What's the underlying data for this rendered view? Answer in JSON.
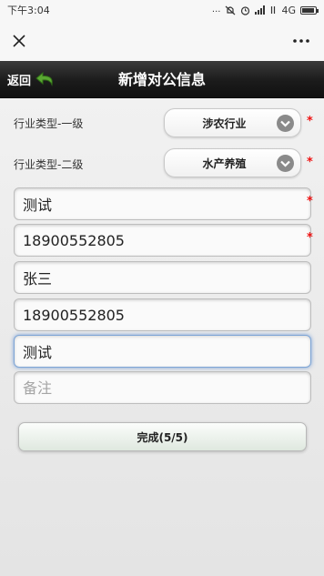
{
  "status_bar": {
    "time": "下午3:04",
    "dots": "...",
    "network": "4G"
  },
  "webview": {
    "close_icon": "close-icon",
    "more_icon": "more-dots-icon"
  },
  "header": {
    "back_label": "返回",
    "title": "新增对公信息",
    "back_icon_color": "#5aa832"
  },
  "form": {
    "industry_level1": {
      "label": "行业类型-一级",
      "value": "涉农行业",
      "required": "*"
    },
    "industry_level2": {
      "label": "行业类型-二级",
      "value": "水产养殖",
      "required": "*"
    },
    "fields": [
      {
        "value": "测试",
        "placeholder": "",
        "required": "*"
      },
      {
        "value": "18900552805",
        "placeholder": "",
        "required": "*"
      },
      {
        "value": "张三",
        "placeholder": ""
      },
      {
        "value": "18900552805",
        "placeholder": ""
      },
      {
        "value": "测试",
        "placeholder": ""
      },
      {
        "value": "",
        "placeholder": "备注"
      }
    ],
    "submit_label": "完成(5/5)"
  },
  "colors": {
    "required": "#ee1111",
    "header_bg": "#1b1b1b",
    "focus_glow": "#5a8cd2"
  }
}
